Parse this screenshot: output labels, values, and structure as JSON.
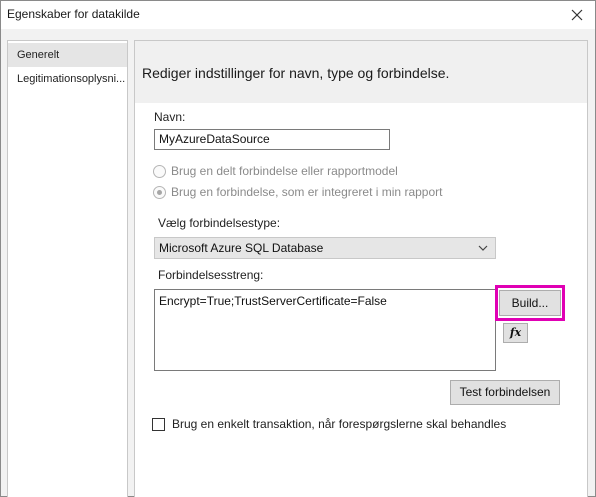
{
  "window": {
    "title": "Egenskaber for datakilde",
    "close_icon": "close-icon"
  },
  "sidebar": {
    "items": [
      {
        "label": "Generelt",
        "selected": true
      },
      {
        "label": "Legitimationsoplysni...",
        "selected": false
      }
    ]
  },
  "main": {
    "header": "Rediger indstillinger for navn, type og forbindelse.",
    "name_label": "Navn:",
    "name_value": "MyAzureDataSource",
    "radio_shared": "Brug en delt forbindelse eller rapportmodel",
    "radio_embedded": "Brug en forbindelse, som er integreret i min rapport",
    "radio_selected": "embedded",
    "conn_type_label": "Vælg forbindelsestype:",
    "conn_type_value": "Microsoft Azure SQL Database",
    "conn_string_label": "Forbindelsesstreng:",
    "conn_string_value": "Encrypt=True;TrustServerCertificate=False",
    "build_button": "Build...",
    "fx_button": "fx",
    "test_button": "Test forbindelsen",
    "single_transaction_label": "Brug en enkelt transaktion, når forespørgslerne skal behandles",
    "single_transaction_checked": false
  },
  "colors": {
    "highlight": "#e000b4",
    "header_bg": "#f0f0f0",
    "selected_bg": "#e5e5e5"
  }
}
